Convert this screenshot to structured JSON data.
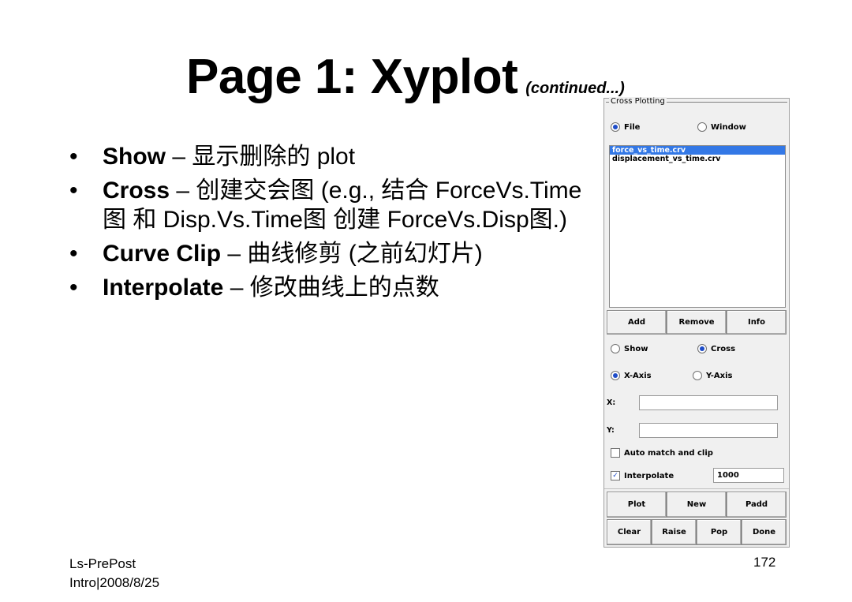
{
  "slide": {
    "title": "Page 1: Xyplot",
    "title_suffix": "(continued...)",
    "bullets": [
      {
        "term": "Show",
        "desc": " – 显示删除的 plot"
      },
      {
        "term": "Cross",
        "desc": " – 创建交会图 (e.g., 结合 ForceVs.Time图 和 Disp.Vs.Time图 创建 ForceVs.Disp图.)"
      },
      {
        "term": "Curve Clip",
        "desc": " – 曲线修剪 (之前幻灯片)"
      },
      {
        "term": "Interpolate",
        "desc": " – 修改曲线上的点数"
      }
    ],
    "footer_left_1": "Ls-PrePost",
    "footer_left_2": "Intro|2008/8/25",
    "page_number": "172"
  },
  "panel": {
    "group_label": "Cross Plotting",
    "source": {
      "file_label": "File",
      "window_label": "Window",
      "selected": "File"
    },
    "curves": [
      {
        "name": "force_vs_time.crv",
        "selected": true
      },
      {
        "name": "displacement_vs_time.crv",
        "selected": false
      }
    ],
    "list_buttons": {
      "add": "Add",
      "remove": "Remove",
      "info": "Info"
    },
    "mode": {
      "show_label": "Show",
      "cross_label": "Cross",
      "selected": "Cross"
    },
    "axis": {
      "x_label": "X-Axis",
      "y_label": "Y-Axis",
      "selected": "X-Axis"
    },
    "x_field": {
      "label": "X:",
      "value": ""
    },
    "y_field": {
      "label": "Y:",
      "value": ""
    },
    "auto_match": {
      "label": "Auto match and clip",
      "checked": false
    },
    "interpolate": {
      "label": "Interpolate",
      "checked": true,
      "value": "1000"
    },
    "action_buttons": {
      "plot": "Plot",
      "new": "New",
      "padd": "Padd"
    },
    "bottom_buttons": {
      "clear": "Clear",
      "raise": "Raise",
      "pop": "Pop",
      "done": "Done"
    }
  },
  "colors": {
    "selection": "#3378e6",
    "radio_dot": "#1e4cc8"
  }
}
